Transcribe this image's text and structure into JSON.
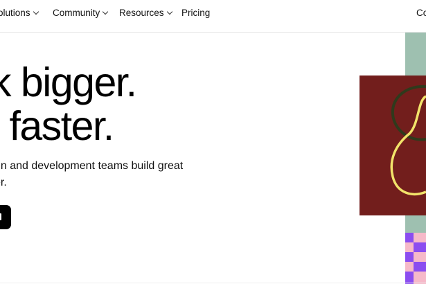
{
  "nav": {
    "items": [
      {
        "label": "olutions",
        "has_dropdown": true
      },
      {
        "label": "Community",
        "has_dropdown": true
      },
      {
        "label": "Resources",
        "has_dropdown": true
      },
      {
        "label": "Pricing",
        "has_dropdown": false
      }
    ],
    "right_label": "Co"
  },
  "hero": {
    "headline_line1": "k bigger.",
    "headline_line2": "l faster.",
    "subtext_line1": "gn and development teams build great",
    "subtext_line2": "er."
  },
  "colors": {
    "background": "#ffffff",
    "text": "#000000",
    "art_green": "#9ec0b0",
    "art_red": "#721e1c",
    "art_line_yellow": "#f2e36a",
    "art_line_green": "#2f3a1c",
    "art_pink": "#f6b9c9",
    "art_purple": "#8b4df0"
  }
}
